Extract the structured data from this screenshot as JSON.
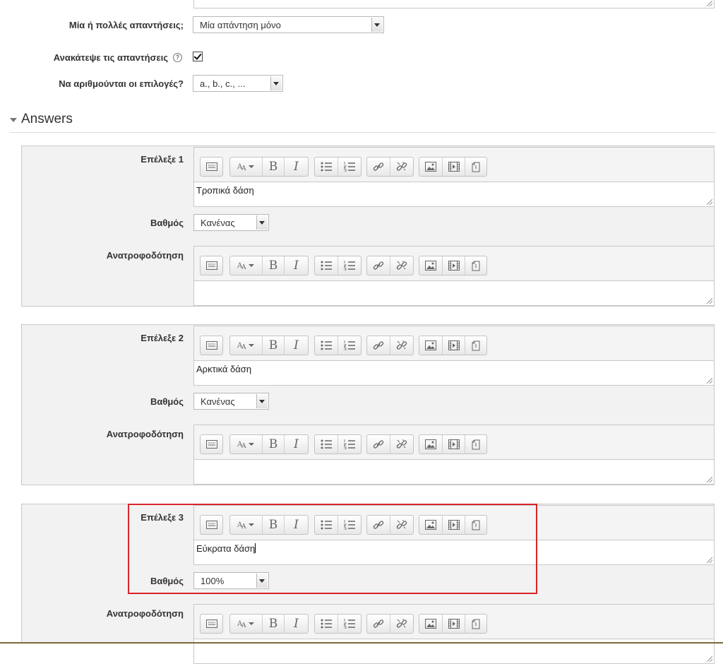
{
  "form": {
    "single_label": "Μία ή πολλές απαντήσεις;",
    "single_value": "Μία απάντηση μόνο",
    "shuffle_label": "Ανακάτεψε τις απαντήσεις",
    "shuffle_checked": true,
    "numbering_label": "Να αριθμούνται οι επιλογές?",
    "numbering_value": "a., b., c., ..."
  },
  "section": {
    "title": "Answers"
  },
  "answers": [
    {
      "choice_label": "Επέλεξε 1",
      "choice_text": "Τροπικά δάση",
      "grade_label": "Βαθμός",
      "grade_value": "Κανένας",
      "feedback_label": "Ανατροφοδότηση",
      "feedback_text": ""
    },
    {
      "choice_label": "Επέλεξε 2",
      "choice_text": "Αρκτικά δάση",
      "grade_label": "Βαθμός",
      "grade_value": "Κανένας",
      "feedback_label": "Ανατροφοδότηση",
      "feedback_text": ""
    },
    {
      "choice_label": "Επέλεξε 3",
      "choice_text": "Εύκρατα δάση",
      "grade_label": "Βαθμός",
      "grade_value": "100%",
      "feedback_label": "Ανατροφοδότηση",
      "feedback_text": ""
    }
  ],
  "toolbar": {
    "icons": [
      "toolbar-toggle-icon",
      "font-style-icon",
      "bold-icon",
      "italic-icon",
      "bullet-list-icon",
      "numbered-list-icon",
      "link-icon",
      "unlink-icon",
      "image-icon",
      "media-icon",
      "file-icon"
    ],
    "bold_glyph": "B",
    "italic_glyph": "I"
  },
  "colors": {
    "highlight": "#d9242a",
    "panel_bg": "#f2f2f2"
  }
}
